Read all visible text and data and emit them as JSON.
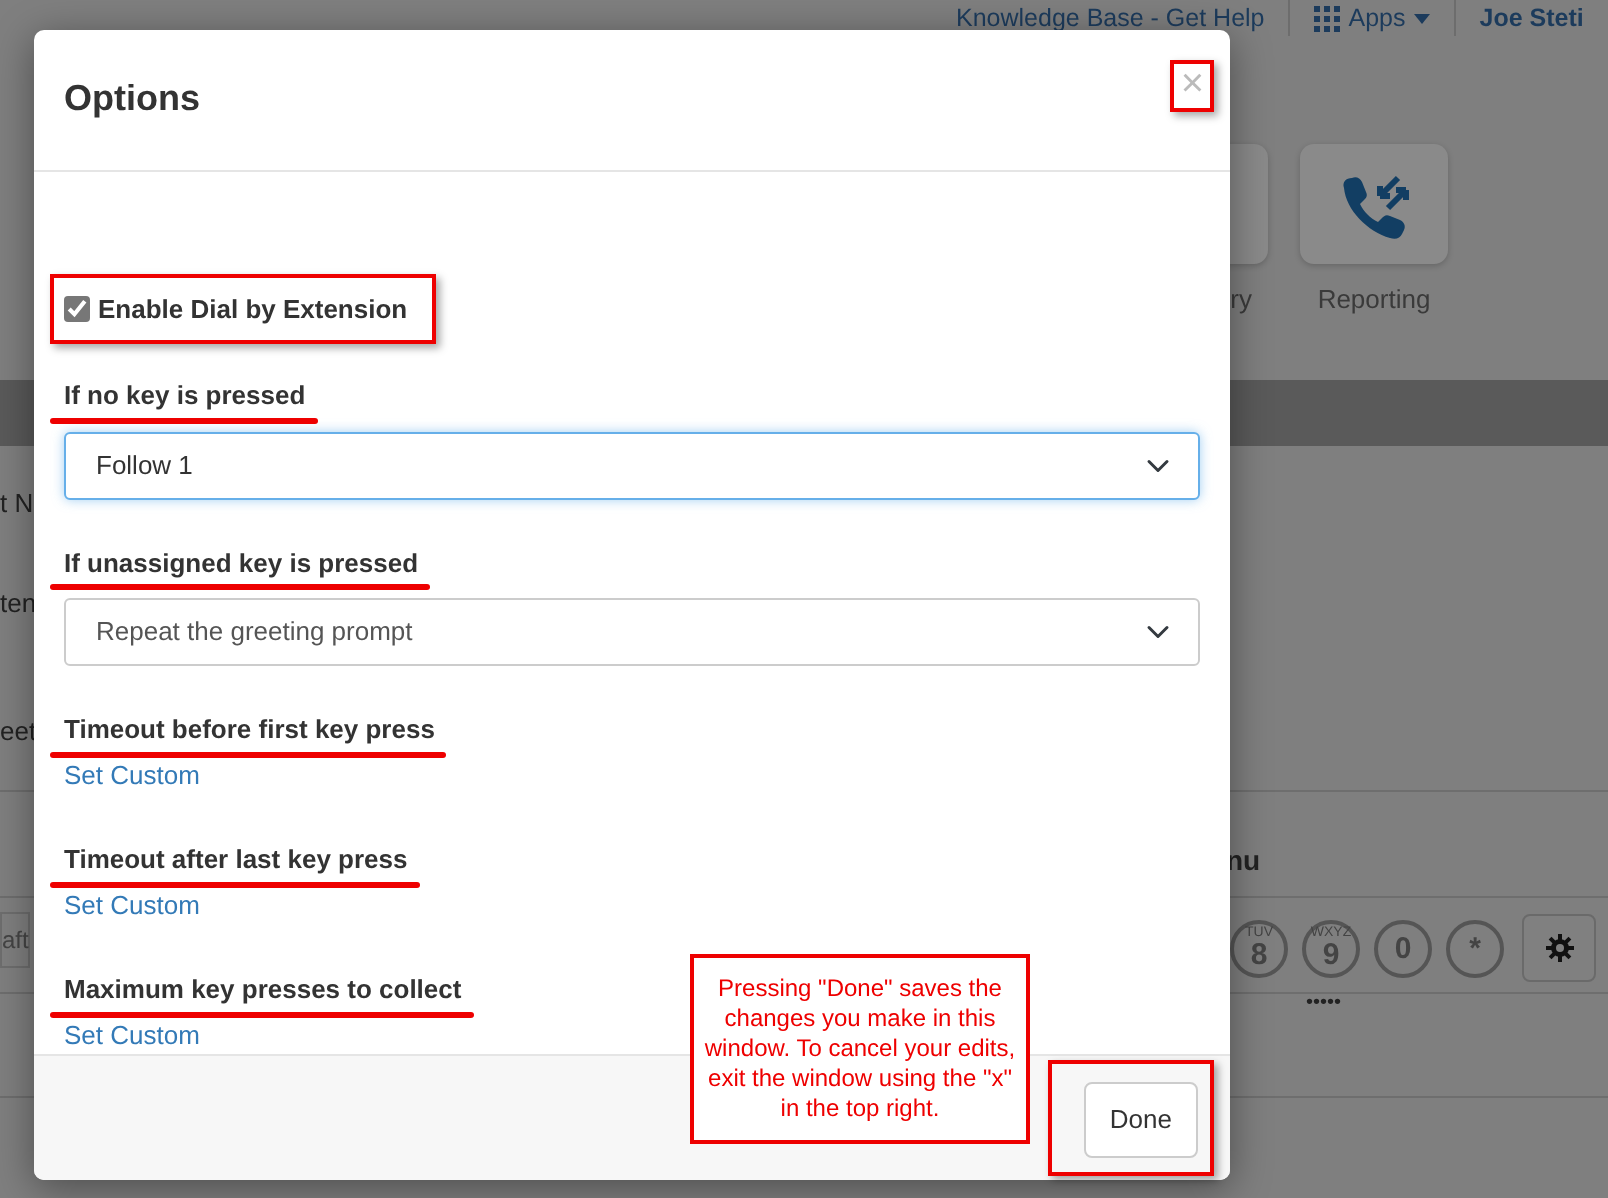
{
  "background": {
    "top_links": [
      {
        "kind": "link",
        "text": "Knowledge Base - Get Help"
      },
      {
        "kind": "apps",
        "text": "Apps"
      },
      {
        "kind": "user",
        "text": "Joe Steti"
      }
    ],
    "tiles": [
      {
        "kind": "partial",
        "label": "ry"
      },
      {
        "kind": "reporting",
        "label": "Reporting"
      }
    ],
    "row_texts": [
      "t N",
      "ten",
      "eet"
    ],
    "field_value": "aft",
    "section_title": "nu",
    "keys": [
      {
        "digit": "8",
        "letters": "TUV"
      },
      {
        "digit": "9",
        "letters": "WXYZ"
      },
      {
        "digit": "0"
      },
      {
        "digit": "*"
      }
    ],
    "dots": "•••••"
  },
  "modal": {
    "title": "Options",
    "close": "×",
    "close_highlighted": true,
    "checkbox": {
      "label": "Enable Dial by Extension",
      "checked": true,
      "highlighted": true
    },
    "fields": [
      {
        "kind": "select",
        "label": "If no key is pressed",
        "value": "Follow 1",
        "focused": true,
        "underlined": true
      },
      {
        "kind": "select",
        "label": "If unassigned key is pressed",
        "value": "Repeat the greeting prompt",
        "focused": false,
        "underlined": true
      },
      {
        "kind": "link",
        "label": "Timeout before first key press",
        "link": "Set Custom",
        "underlined": true
      },
      {
        "kind": "link",
        "label": "Timeout after last key press",
        "link": "Set Custom",
        "underlined": true
      },
      {
        "kind": "link",
        "label": "Maximum key presses to collect",
        "link": "Set Custom",
        "underlined": true
      }
    ],
    "done": "Done",
    "done_highlighted": true
  },
  "callout": "Pressing \"Done\" saves the changes you make in this window. To cancel your edits, exit the window using the \"x\" in the top right."
}
